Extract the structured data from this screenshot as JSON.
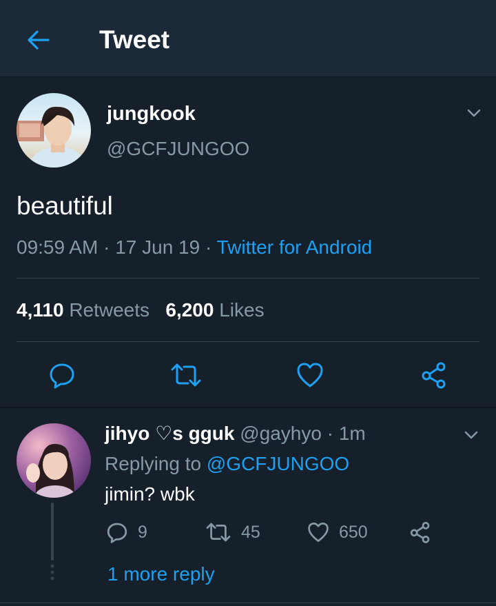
{
  "header": {
    "title": "Tweet"
  },
  "tweet": {
    "author_name": "jungkook",
    "author_handle": "@GCFJUNGOO",
    "text": "beautiful",
    "time": "09:59 AM",
    "date": "17 Jun 19",
    "source": "Twitter for Android",
    "sep": " · ",
    "retweets_count": "4,110",
    "retweets_label": "Retweets",
    "likes_count": "6,200",
    "likes_label": "Likes"
  },
  "reply": {
    "author_name": "jihyo ♡s gguk",
    "author_handle": "@gayhyo",
    "age": "· 1m",
    "replying_prefix": "Replying to",
    "replying_to": "@GCFJUNGOO",
    "text": "jimin? wbk",
    "reply_count": "9",
    "retweet_count": "45",
    "like_count": "650",
    "more_replies": "1 more reply"
  },
  "colors": {
    "background": "#15202b",
    "header": "#1c2938",
    "accent": "#1da1f2",
    "secondary_text": "#8899a6",
    "divider": "#38444d"
  },
  "icons": [
    "back-arrow-icon",
    "chevron-down-icon",
    "reply-icon",
    "retweet-icon",
    "like-icon",
    "share-icon"
  ]
}
